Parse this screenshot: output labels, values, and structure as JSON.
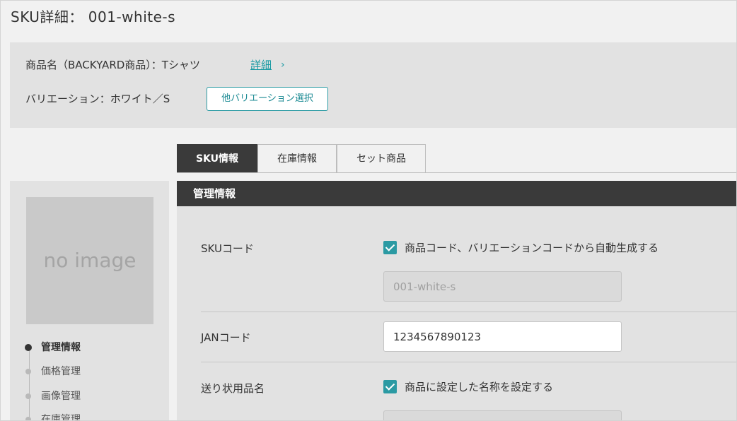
{
  "page": {
    "title": "SKU詳細： 001-white-s"
  },
  "product": {
    "name_line": "商品名（BACKYARD商品）：Tシャツ",
    "detail_link": "詳細",
    "detail_chevron": "›",
    "variation_line": "バリエーション：ホワイト／S",
    "other_variation_button": "他バリエーション選択"
  },
  "sidebar": {
    "no_image": "no image",
    "nav": [
      {
        "label": "管理情報",
        "active": true
      },
      {
        "label": "価格管理",
        "active": false
      },
      {
        "label": "画像管理",
        "active": false
      },
      {
        "label": "在庫管理",
        "active": false
      }
    ]
  },
  "tabs": [
    {
      "label": "SKU情報",
      "active": true
    },
    {
      "label": "在庫情報",
      "active": false
    },
    {
      "label": "セット商品",
      "active": false
    }
  ],
  "section": {
    "title": "管理情報"
  },
  "form": {
    "sku_code": {
      "label": "SKUコード",
      "auto_checkbox_label": "商品コード、バリエーションコードから自動生成する",
      "auto_checked": true,
      "value": "001-white-s"
    },
    "jan_code": {
      "label": "JANコード",
      "value": "1234567890123"
    },
    "shipping_name": {
      "label": "送り状用品名",
      "checkbox_label": "商品に設定した名称を設定する",
      "checked": true
    }
  },
  "colors": {
    "accent": "#2b9aa3",
    "dark_header": "#3a3a3a",
    "panel_bg": "#e2e2e2",
    "page_bg": "#f1f1f1"
  }
}
